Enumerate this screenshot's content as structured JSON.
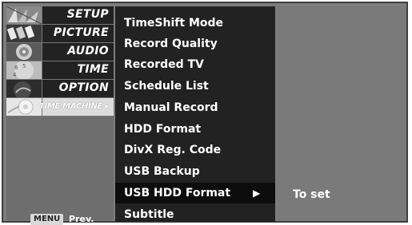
{
  "categories": [
    {
      "label": "SETUP",
      "icon": "setup-icon",
      "active": false
    },
    {
      "label": "PICTURE",
      "icon": "picture-icon",
      "active": false
    },
    {
      "label": "AUDIO",
      "icon": "audio-icon",
      "active": false
    },
    {
      "label": "TIME",
      "icon": "time-icon",
      "active": false
    },
    {
      "label": "OPTION",
      "icon": "option-icon",
      "active": false
    },
    {
      "label": "TIME MACHINE ▸",
      "icon": "time-machine-icon",
      "active": true
    }
  ],
  "footer": {
    "menu_key": "MENU",
    "prev_label": "Prev."
  },
  "items": [
    {
      "label": "TimeShift Mode"
    },
    {
      "label": "Record Quality"
    },
    {
      "label": "Recorded TV"
    },
    {
      "label": "Schedule List"
    },
    {
      "label": "Manual Record"
    },
    {
      "label": "HDD Format"
    },
    {
      "label": "DivX Reg. Code"
    },
    {
      "label": "USB Backup"
    },
    {
      "label": "USB HDD Format",
      "arrow": "▶",
      "selected": true
    },
    {
      "label": "Subtitle"
    }
  ],
  "value": {
    "text": "To set"
  },
  "colors": {
    "panel": "#7d7d7d",
    "list_bg": "#222222",
    "text": "#ffffff"
  }
}
